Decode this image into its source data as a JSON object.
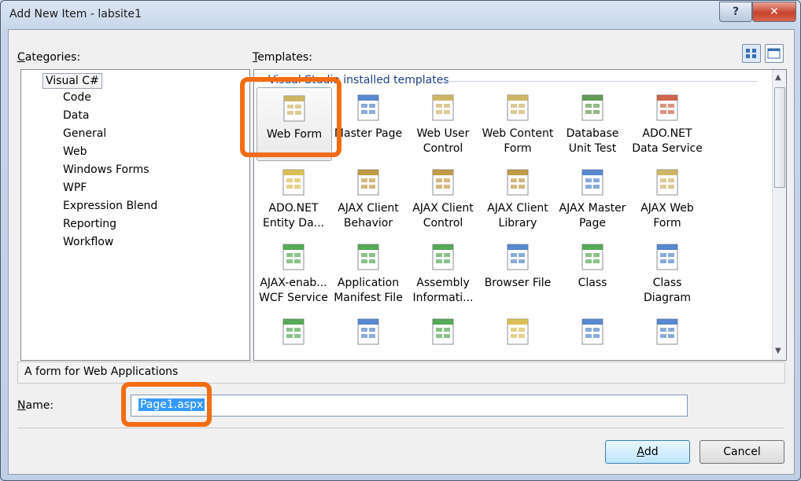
{
  "window": {
    "title": "Add New Item - labsite1"
  },
  "caption_buttons": {
    "help": "?",
    "close": "✕"
  },
  "labels": {
    "categories_pre": "",
    "categories_u": "C",
    "categories_post": "ategories:",
    "templates_pre": "",
    "templates_u": "T",
    "templates_post": "emplates:",
    "name_pre": "",
    "name_u": "N",
    "name_post": "ame:"
  },
  "categories": {
    "root": "Visual C#",
    "items": [
      "Code",
      "Data",
      "General",
      "Web",
      "Windows Forms",
      "WPF",
      "Expression Blend",
      "Reporting",
      "Workflow"
    ]
  },
  "templates": {
    "group_header": "Visual Studio installed templates",
    "items": [
      {
        "line1": "Web Form",
        "line2": "",
        "icon": "web-form-icon",
        "color": "#c7a94c"
      },
      {
        "line1": "Master Page",
        "line2": "",
        "icon": "master-page-icon",
        "color": "#3b73c4"
      },
      {
        "line1": "Web User",
        "line2": "Control",
        "icon": "web-user-control-icon",
        "color": "#c7a94c"
      },
      {
        "line1": "Web Content",
        "line2": "Form",
        "icon": "web-content-form-icon",
        "color": "#c7a94c"
      },
      {
        "line1": "Database",
        "line2": "Unit Test",
        "icon": "database-unit-test-icon",
        "color": "#4a8a3c"
      },
      {
        "line1": "ADO.NET",
        "line2": "Data Service",
        "icon": "ado-net-data-service-icon",
        "color": "#c64b2f"
      },
      {
        "line1": "ADO.NET",
        "line2": "Entity Da...",
        "icon": "ado-net-entity-icon",
        "color": "#d4b43a"
      },
      {
        "line1": "AJAX Client",
        "line2": "Behavior",
        "icon": "ajax-client-behavior-icon",
        "color": "#b58a2a"
      },
      {
        "line1": "AJAX Client",
        "line2": "Control",
        "icon": "ajax-client-control-icon",
        "color": "#b58a2a"
      },
      {
        "line1": "AJAX Client",
        "line2": "Library",
        "icon": "ajax-client-library-icon",
        "color": "#b58a2a"
      },
      {
        "line1": "AJAX Master",
        "line2": "Page",
        "icon": "ajax-master-page-icon",
        "color": "#3b73c4"
      },
      {
        "line1": "AJAX Web",
        "line2": "Form",
        "icon": "ajax-web-form-icon",
        "color": "#c7a94c"
      },
      {
        "line1": "AJAX-enab...",
        "line2": "WCF Service",
        "icon": "ajax-wcf-service-icon",
        "color": "#3a9a3a"
      },
      {
        "line1": "Application",
        "line2": "Manifest File",
        "icon": "application-manifest-icon",
        "color": "#3a9a3a"
      },
      {
        "line1": "Assembly",
        "line2": "Informati...",
        "icon": "assembly-info-icon",
        "color": "#3a9a3a"
      },
      {
        "line1": "Browser File",
        "line2": "",
        "icon": "browser-file-icon",
        "color": "#3b73c4"
      },
      {
        "line1": "Class",
        "line2": "",
        "icon": "class-icon",
        "color": "#3a9a3a"
      },
      {
        "line1": "Class",
        "line2": "Diagram",
        "icon": "class-diagram-icon",
        "color": "#3b73c4"
      },
      {
        "line1": "",
        "line2": "",
        "icon": "code-file-icon",
        "color": "#3a9a3a"
      },
      {
        "line1": "",
        "line2": "",
        "icon": "dataset-icon",
        "color": "#3b73c4"
      },
      {
        "line1": "",
        "line2": "",
        "icon": "debugger-visualizer-icon",
        "color": "#3a9a3a"
      },
      {
        "line1": "",
        "line2": "",
        "icon": "dynamic-data-icon",
        "color": "#d4b43a"
      },
      {
        "line1": "",
        "line2": "",
        "icon": "generic-handler-icon",
        "color": "#3b73c4"
      },
      {
        "line1": "",
        "line2": "",
        "icon": "global-application-icon",
        "color": "#3b73c4"
      }
    ]
  },
  "description": "A form for Web Applications",
  "name_field": {
    "value": "Page1.aspx"
  },
  "buttons": {
    "add_pre": "",
    "add_u": "A",
    "add_post": "dd",
    "cancel": "Cancel"
  },
  "colors": {
    "highlight": "#f26d12",
    "selection": "#3399ff"
  }
}
